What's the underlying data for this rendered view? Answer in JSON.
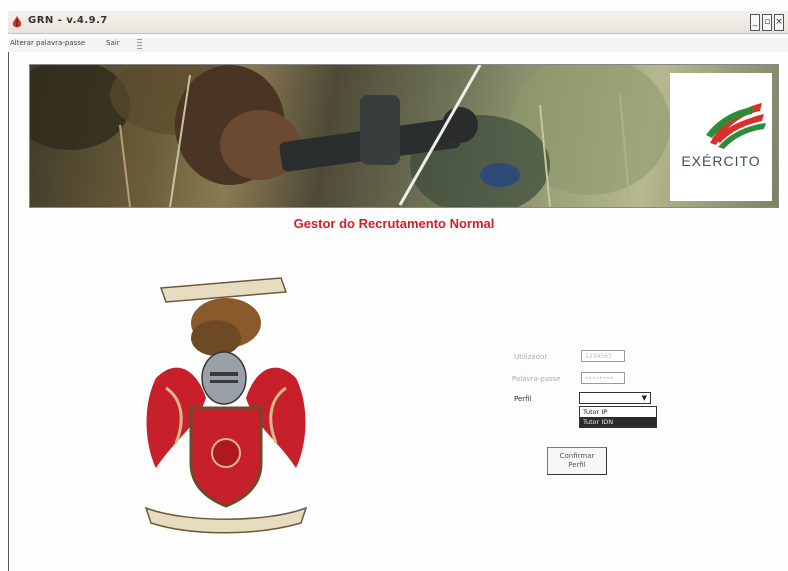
{
  "window": {
    "title": "GRN - v.4.9.7",
    "controls": [
      "minimize-icon",
      "maximize-icon",
      "close-icon"
    ]
  },
  "menu": {
    "items": [
      {
        "label": "Alterar palavra-passe"
      },
      {
        "label": "Sair"
      }
    ]
  },
  "banner": {
    "logo_text": "EXÉRCITO"
  },
  "page": {
    "title": "Gestor do Recrutamento Normal"
  },
  "login": {
    "user_label": "Utilizador",
    "user_value": "1234567",
    "password_label": "Palavra-passe",
    "password_value": "••••••••",
    "profile_label": "Perfil",
    "profile_value": "",
    "profile_options": [
      "Tutor IP",
      "Tutor IDN"
    ],
    "highlighted_option_index": 1,
    "confirm_line1": "Confirmar",
    "confirm_line2": "Perfil"
  },
  "colors": {
    "title_red": "#d0202f",
    "logo_blue": "#3d4f63",
    "logo_red": "#d9302a",
    "logo_green": "#2e8b3a"
  }
}
